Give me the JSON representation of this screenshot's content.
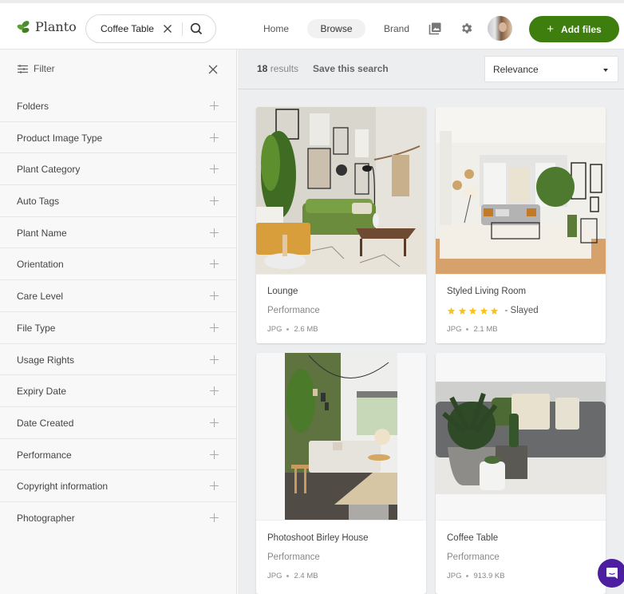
{
  "header": {
    "brand": "Planto",
    "search": {
      "value": "Coffee Table",
      "placeholder": "Search"
    },
    "nav": [
      {
        "label": "Home",
        "active": false
      },
      {
        "label": "Browse",
        "active": true
      },
      {
        "label": "Brand",
        "active": false
      }
    ],
    "icons": [
      "gallery-icon",
      "gear-icon",
      "user-avatar"
    ],
    "add_button": {
      "icon": "plus",
      "label": "Add files"
    },
    "accent_color": "#3e7e0e"
  },
  "sidebar": {
    "title": "Filter",
    "facets": [
      {
        "label": "Folders"
      },
      {
        "label": "Product Image Type"
      },
      {
        "label": "Plant Category"
      },
      {
        "label": "Auto Tags"
      },
      {
        "label": "Plant Name"
      },
      {
        "label": "Orientation"
      },
      {
        "label": "Care Level"
      },
      {
        "label": "File Type"
      },
      {
        "label": "Usage Rights"
      },
      {
        "label": "Expiry Date"
      },
      {
        "label": "Date Created"
      },
      {
        "label": "Performance"
      },
      {
        "label": "Copyright information"
      },
      {
        "label": "Photographer"
      }
    ]
  },
  "results": {
    "count": "18",
    "count_suffix": "results",
    "save_search": "Save this search",
    "sort": {
      "selected": "Relevance"
    },
    "cards": [
      {
        "title": "Lounge",
        "subtitle": "Performance",
        "format": "JPG",
        "size": "2.6 MB",
        "image": "living room with green sofa, gallery wall and plants"
      },
      {
        "title": "Styled Living Room",
        "rating": 5,
        "rating_label": "- Slayed",
        "format": "JPG",
        "size": "2.1 MB",
        "image": "bright living room with grey sofa and palm"
      },
      {
        "title": "Photoshoot Birley House",
        "subtitle": "Performance",
        "format": "JPG",
        "size": "2.4 MB",
        "image": "green wall room with white sectional sofa (portrait)"
      },
      {
        "title": "Coffee Table",
        "subtitle": "Performance",
        "format": "JPG",
        "size": "913.9 KB",
        "image": "succulents in pots on white table (landscape)"
      }
    ],
    "star_color": "#f6c327"
  },
  "chat": {
    "icon": "chat-icon",
    "color": "#4b1fa0"
  }
}
